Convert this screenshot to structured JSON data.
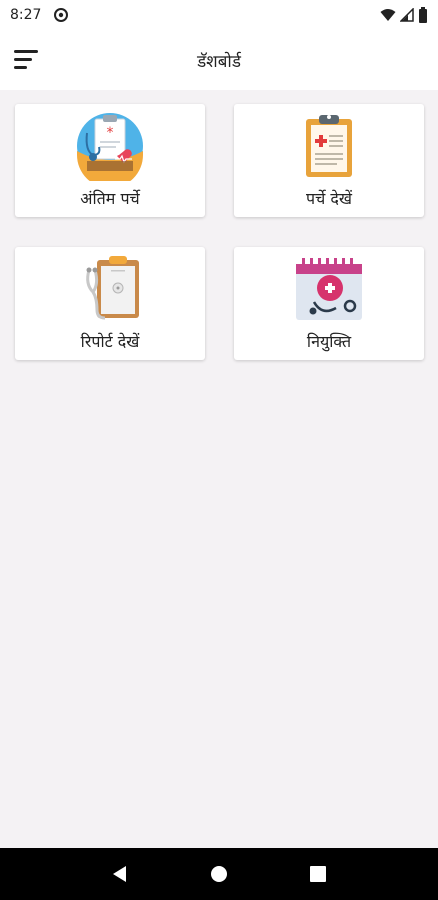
{
  "status_bar": {
    "time": "8:27"
  },
  "app_bar": {
    "title": "डॅशबोर्ड"
  },
  "cards": [
    {
      "label": "अंतिम पर्चे",
      "icon": "doctor-clipboard-icon"
    },
    {
      "label": "पर्चे देखें",
      "icon": "clipboard-icon"
    },
    {
      "label": "रिपोर्ट देखें",
      "icon": "report-stethoscope-icon"
    },
    {
      "label": "नियुक्ति",
      "icon": "calendar-appointment-icon"
    }
  ],
  "colors": {
    "background": "#f4f2f4",
    "card": "#ffffff",
    "nav_bar": "#000000"
  }
}
